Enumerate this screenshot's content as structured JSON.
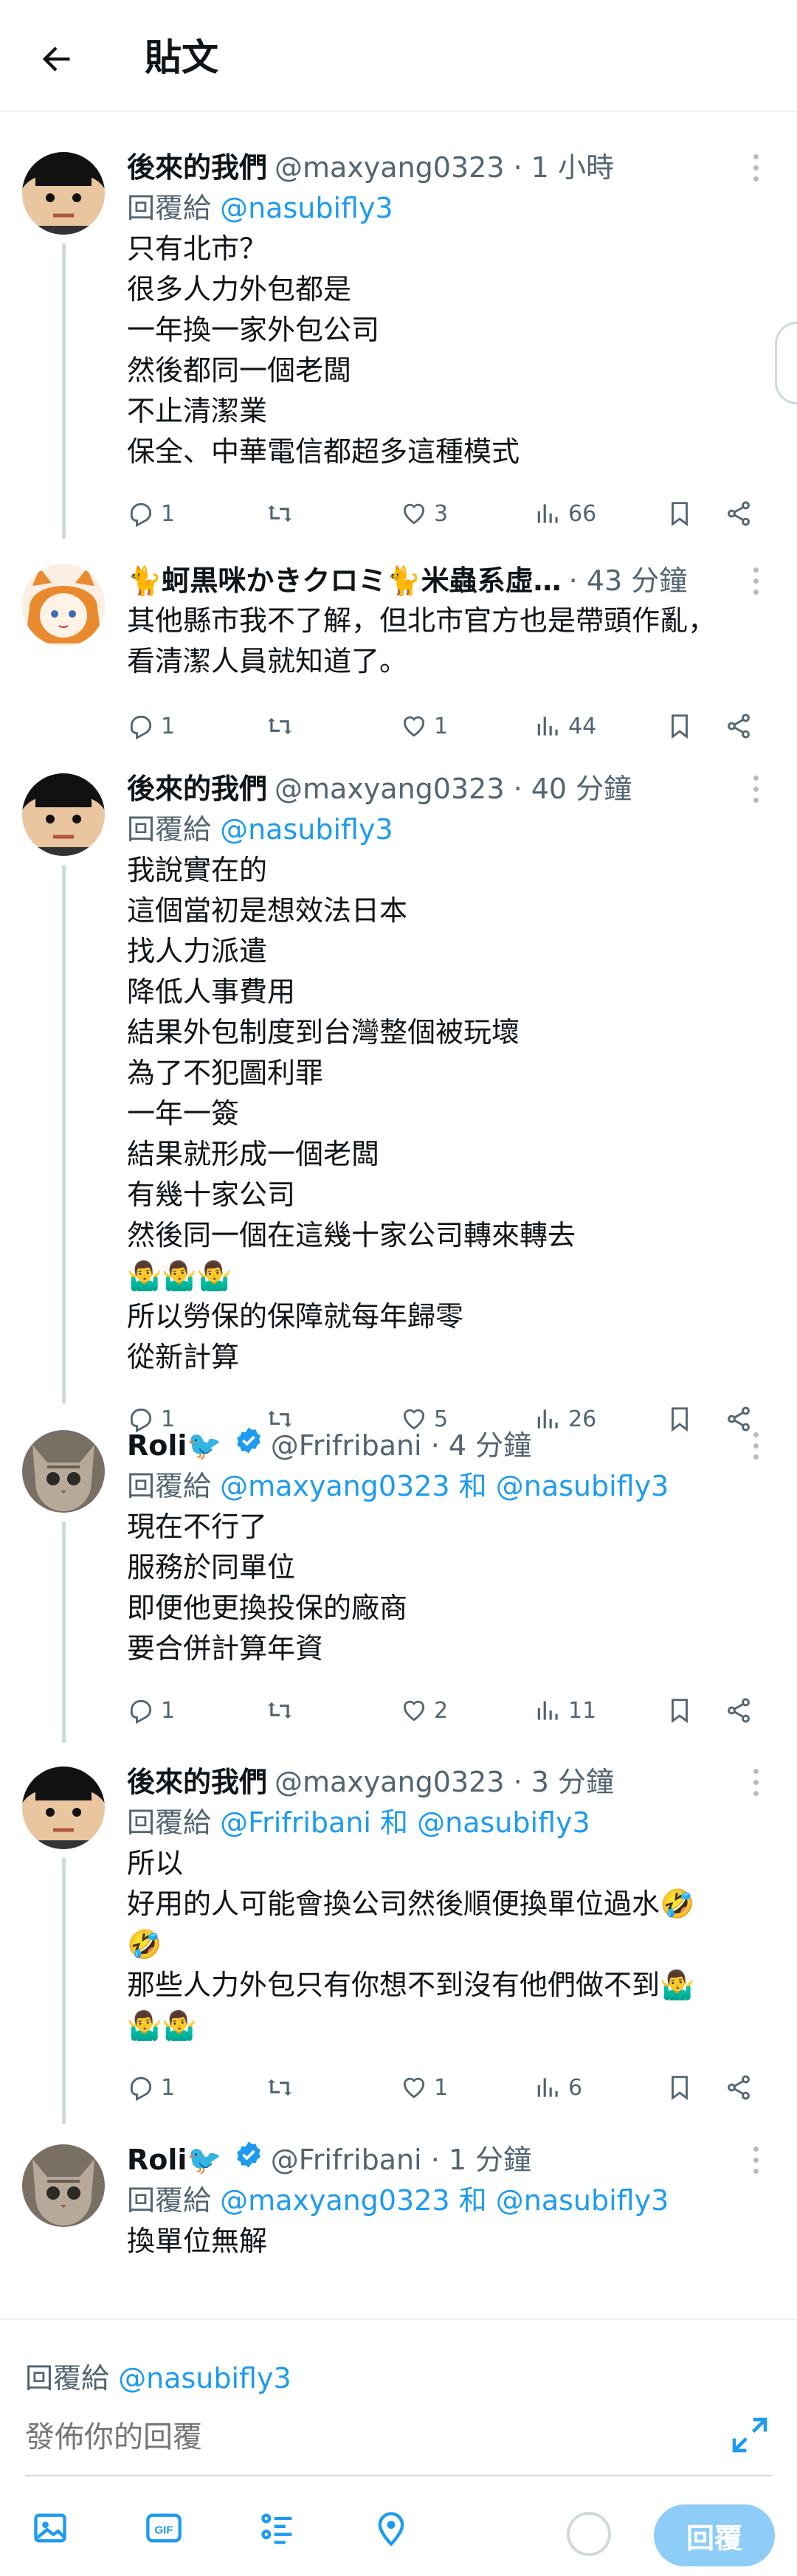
{
  "header": {
    "title": "貼文"
  },
  "tweets": [
    {
      "name": "後來的我們",
      "meta": "@maxyang0323 · 1 小時",
      "reply_prefix": "回覆給 ",
      "reply_targets": "@nasubifly3",
      "body": "只有北市？\n很多人力外包都是\n一年換一家外包公司\n然後都同一個老闆\n不止清潔業\n保全、中華電信都超多這種模式",
      "replies": "1",
      "retweets": "",
      "likes": "3",
      "views": "66",
      "avatar": "face-avatar"
    },
    {
      "name": "🐈蚵黒咪かきクロミ🐈米蟲系虛…",
      "meta": "· 43 分鐘",
      "reply_prefix": "",
      "reply_targets": "",
      "body": "其他縣市我不了解，但北市官方也是帶頭作亂，看清潔人員就知道了。",
      "replies": "1",
      "retweets": "",
      "likes": "1",
      "views": "44",
      "avatar": "anime-avatar"
    },
    {
      "name": "後來的我們",
      "meta": "@maxyang0323 · 40 分鐘",
      "reply_prefix": "回覆給 ",
      "reply_targets": "@nasubifly3",
      "body": "我說實在的\n這個當初是想效法日本\n找人力派遣\n降低人事費用\n結果外包制度到台灣整個被玩壞\n為了不犯圖利罪\n一年一簽\n結果就形成一個老闆\n有幾十家公司\n然後同一個在這幾十家公司轉來轉去\n🤷‍♂️🤷‍♂️🤷‍♂️\n所以勞保的保障就每年歸零\n從新計算",
      "replies": "1",
      "retweets": "",
      "likes": "5",
      "views": "26",
      "avatar": "face-avatar"
    },
    {
      "name": "Roli🐦",
      "meta": "@Frifribani · 4 分鐘",
      "reply_prefix": "回覆給 ",
      "reply_targets": "@maxyang0323 和 @nasubifly3",
      "body": "現在不行了\n服務於同單位\n即便他更換投保的廠商\n要合併計算年資",
      "replies": "1",
      "retweets": "",
      "likes": "2",
      "views": "11",
      "avatar": "cat-avatar"
    },
    {
      "name": "後來的我們",
      "meta": "@maxyang0323 · 3 分鐘",
      "reply_prefix": "回覆給 ",
      "reply_targets": "@Frifribani 和 @nasubifly3",
      "body": "所以\n好用的人可能會換公司然後順便換單位過水🤣\n🤣\n那些人力外包只有你想不到沒有他們做不到🤷‍♂️\n🤷‍♂️🤷‍♂️",
      "replies": "1",
      "retweets": "",
      "likes": "1",
      "views": "6",
      "avatar": "face-avatar"
    },
    {
      "name": "Roli🐦",
      "meta": "@Frifribani · 1 分鐘",
      "reply_prefix": "回覆給 ",
      "reply_targets": "@maxyang0323 和 @nasubifly3",
      "body": "換單位無解",
      "replies": "",
      "retweets": "",
      "likes": "",
      "views": "",
      "avatar": "cat-avatar"
    }
  ],
  "composer": {
    "reply_prefix": "回覆給 ",
    "reply_target": "@nasubifly3",
    "placeholder": "發佈你的回覆",
    "submit_label": "回覆"
  },
  "colors": {
    "accent": "#1d9bf0",
    "text": "#0f1419",
    "muted": "#536471",
    "submit_disabled": "#8ecdf8"
  }
}
